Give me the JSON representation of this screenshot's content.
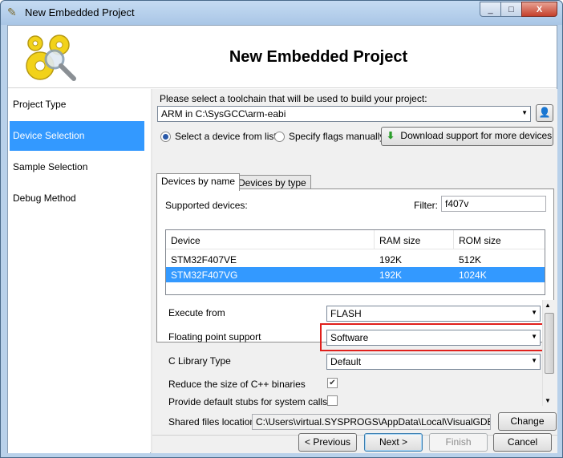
{
  "window": {
    "title": "New Embedded Project",
    "controls": [
      "_",
      "□",
      "X"
    ]
  },
  "header": {
    "title": "New Embedded Project"
  },
  "sidebar": {
    "items": [
      {
        "label": "Project Type",
        "active": false
      },
      {
        "label": "Device Selection",
        "active": true
      },
      {
        "label": "Sample Selection",
        "active": false
      },
      {
        "label": "Debug Method",
        "active": false
      }
    ]
  },
  "toolchain": {
    "prompt": "Please select a toolchain that will be used to build your project:",
    "selected": "ARM in C:\\SysGCC\\arm-eabi"
  },
  "mode": {
    "option_list": "Select a device from list",
    "option_flags": "Specify flags manually",
    "download_button": "Download support for more devices",
    "selected": "list"
  },
  "tabs": [
    {
      "label": "Devices by name",
      "active": true
    },
    {
      "label": "Devices by type",
      "active": false
    }
  ],
  "devices": {
    "supported_label": "Supported devices:",
    "filter_label": "Filter:",
    "filter_value": "f407v",
    "columns": [
      "Device",
      "RAM size",
      "ROM size"
    ],
    "rows": [
      {
        "device": "STM32F407VE",
        "ram": "192K",
        "rom": "512K",
        "selected": false
      },
      {
        "device": "STM32F407VG",
        "ram": "192K",
        "rom": "1024K",
        "selected": true
      }
    ]
  },
  "properties": {
    "execute_from": {
      "label": "Execute from",
      "value": "FLASH"
    },
    "floating_point": {
      "label": "Floating point support",
      "value": "Software"
    },
    "c_library": {
      "label": "C Library Type",
      "value": "Default"
    },
    "reduce_size": {
      "label": "Reduce the size of C++ binaries",
      "checked": true
    },
    "default_stubs": {
      "label": "Provide default stubs for system calls",
      "checked": false
    }
  },
  "shared": {
    "label": "Shared files location:",
    "path": "C:\\Users\\virtual.SYSPROGS\\AppData\\Local\\VisualGDB\\Emb",
    "change_button": "Change"
  },
  "nav": {
    "previous": "< Previous",
    "next": "Next >",
    "finish": "Finish",
    "cancel": "Cancel"
  },
  "colors": {
    "selection": "#3399ff",
    "highlight_box": "#e0201c",
    "title_bar": "#b9d1ea"
  }
}
